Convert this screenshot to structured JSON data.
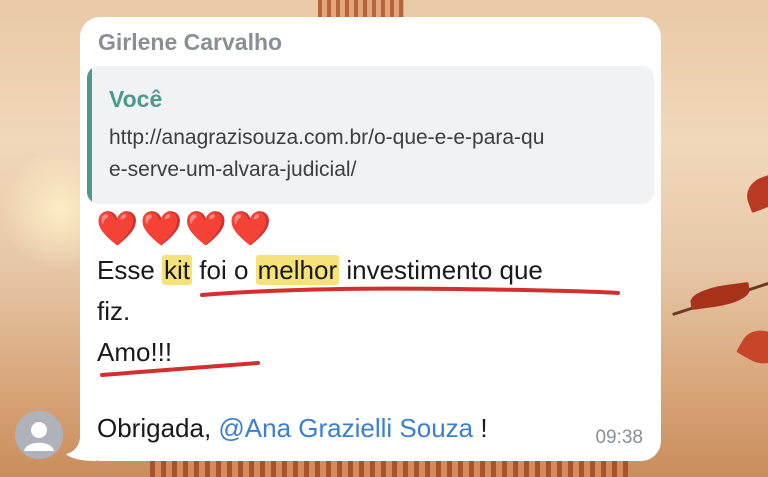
{
  "chat": {
    "sender_name": "Girlene Carvalho",
    "reply": {
      "author": "Você",
      "text": "http://anagrazisouza.com.br/o-que-e-e-para-que-serve-um-alvara-judicial/"
    },
    "message": {
      "hearts": "❤️❤️❤️❤️",
      "line1": {
        "before_kit": "Esse ",
        "kit": "kit",
        "middle": " foi o ",
        "melhor": "melhor",
        "after": " investimento que"
      },
      "line2": "fiz.",
      "line3": "Amo!!!",
      "line4": {
        "prefix": "Obrigada, ",
        "mention": "@Ana Grazielli Souza",
        "suffix": " !"
      }
    },
    "time": "09:38"
  },
  "colors": {
    "highlight": "#f6e27a",
    "underline": "#d32f2f",
    "mention": "#3b7fd4",
    "quote_accent": "#4c9a8c"
  },
  "icons": {
    "avatar": "user-avatar-icon"
  }
}
